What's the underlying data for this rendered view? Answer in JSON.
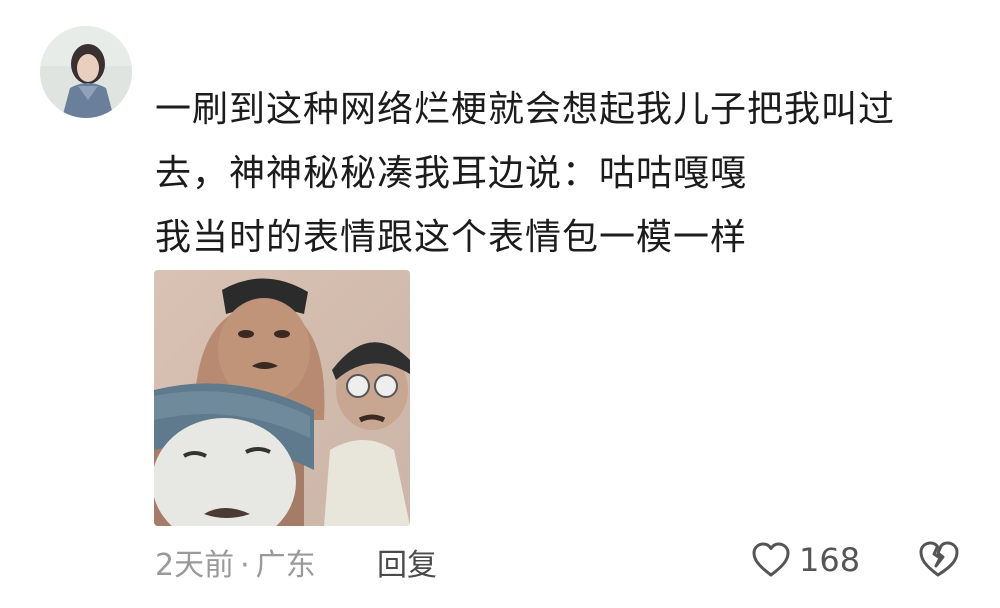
{
  "comment": {
    "lines": [
      "一刷到这种网络烂梗就会想起我儿子把我叫过",
      "去，神神秘秘凑我耳边说：咕咕嘎嘎",
      "我当时的表情跟这个表情包一模一样"
    ],
    "time": "2天前",
    "separator": "·",
    "location": "广东",
    "reply_label": "回复",
    "like_count": "168"
  },
  "icons": {
    "avatar": "user-avatar",
    "like": "heart-icon",
    "dislike": "broken-heart-icon"
  },
  "colors": {
    "text": "#1c1c1c",
    "meta": "#9a9a9a",
    "icon": "#555555"
  }
}
